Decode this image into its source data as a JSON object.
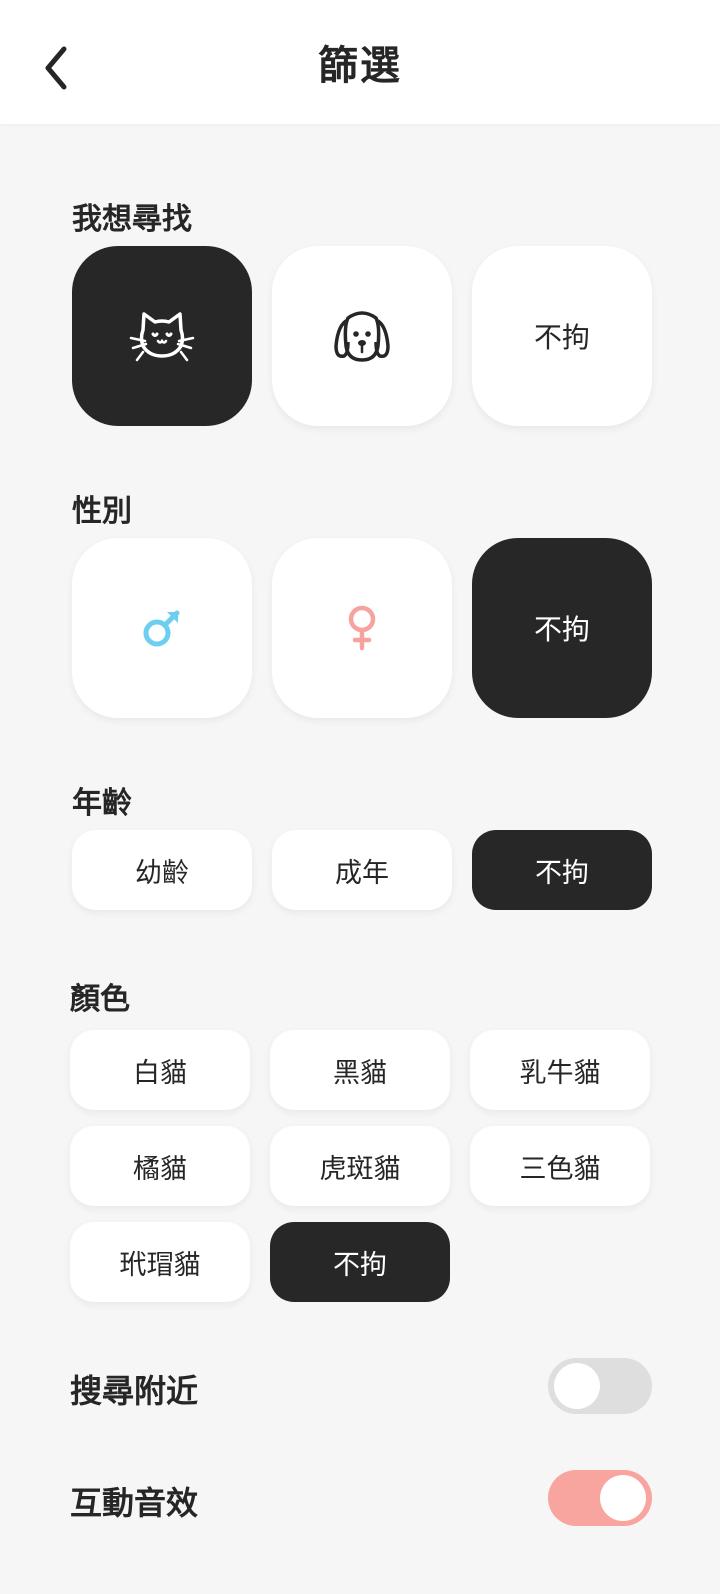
{
  "header": {
    "title": "篩選",
    "back_icon": "chevron-left-icon"
  },
  "looking_for": {
    "label": "我想尋找",
    "options": [
      {
        "icon": "cat-icon",
        "selected": true
      },
      {
        "icon": "dog-icon",
        "selected": false
      },
      {
        "label": "不拘",
        "selected": false
      }
    ]
  },
  "gender": {
    "label": "性別",
    "options": [
      {
        "icon": "male-icon",
        "color": "#6ccff0",
        "selected": false
      },
      {
        "icon": "female-icon",
        "color": "#f6a39d",
        "selected": false
      },
      {
        "label": "不拘",
        "selected": true
      }
    ]
  },
  "age": {
    "label": "年齡",
    "options": [
      {
        "label": "幼齡",
        "selected": false
      },
      {
        "label": "成年",
        "selected": false
      },
      {
        "label": "不拘",
        "selected": true
      }
    ]
  },
  "color": {
    "label": "顏色",
    "options": [
      {
        "label": "白貓",
        "selected": false
      },
      {
        "label": "黑貓",
        "selected": false
      },
      {
        "label": "乳牛貓",
        "selected": false
      },
      {
        "label": "橘貓",
        "selected": false
      },
      {
        "label": "虎斑貓",
        "selected": false
      },
      {
        "label": "三色貓",
        "selected": false
      },
      {
        "label": "玳瑁貓",
        "selected": false
      },
      {
        "label": "不拘",
        "selected": true
      }
    ]
  },
  "settings": {
    "nearby": {
      "label": "搜尋附近",
      "on": false
    },
    "sound": {
      "label": "互動音效",
      "on": true
    }
  },
  "colors": {
    "selected": "#272727",
    "toggle_on": "#f8a5a0",
    "toggle_off": "#dedede"
  }
}
